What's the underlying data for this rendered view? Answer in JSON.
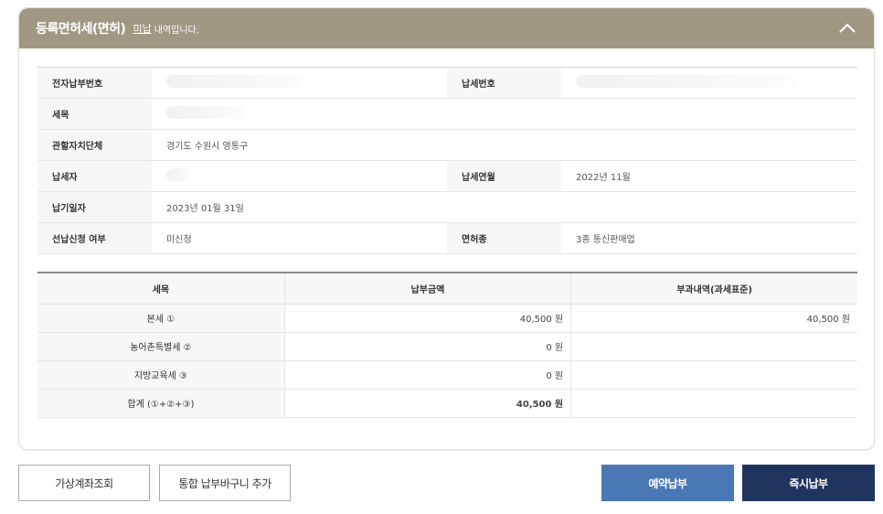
{
  "header": {
    "title": "등록면허세(면허)",
    "status": "미납",
    "desc": "내역입니다."
  },
  "info": {
    "rows": [
      {
        "label1": "전자납부번호",
        "value1": "",
        "label2": "납세번호",
        "value2": ""
      },
      {
        "label1": "세목",
        "value1": ""
      },
      {
        "label1": "관할자치단체",
        "value1": "경기도 수원시 영통구"
      },
      {
        "label1": "납세자",
        "value1": "",
        "label2": "납세연월",
        "value2": "2022년 11월"
      },
      {
        "label1": "납기일자",
        "value1": "2023년 01월 31일"
      },
      {
        "label1": "선납신청 여부",
        "value1": "미신청",
        "label2": "면허종",
        "value2": "3종 통신판매업"
      }
    ]
  },
  "amounts": {
    "headers": [
      "세목",
      "납부금액",
      "부과내역(과세표준)"
    ],
    "rows": [
      {
        "name": "본세 ①",
        "amount": "40,500 원",
        "base": "40,500 원"
      },
      {
        "name": "농어촌특별세 ②",
        "amount": "0 원",
        "base": ""
      },
      {
        "name": "지방교육세 ③",
        "amount": "0 원",
        "base": ""
      },
      {
        "name": "합계 (①+②+③)",
        "amount": "40,500 원",
        "base": ""
      }
    ]
  },
  "buttons": {
    "virtual_account": "가상계좌조회",
    "add_cart": "통합 납부바구니 추가",
    "reserve_pay": "예약납부",
    "instant_pay": "즉시납부"
  },
  "colors": {
    "header_bg": "#a19883",
    "reserve_btn": "#4a78b5",
    "instant_btn": "#1f3560"
  },
  "icons": {
    "collapse": "chevron-up-icon"
  }
}
